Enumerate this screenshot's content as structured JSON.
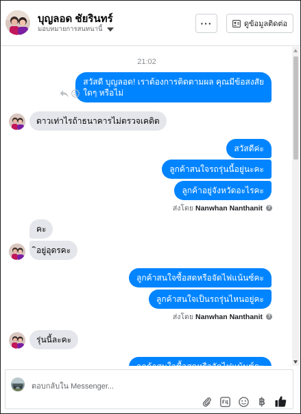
{
  "header": {
    "contact_name": "บุญลอด ชัยรินทร์",
    "assign_label": "มอบหมายการสนทนานี้",
    "more_label": "···",
    "contact_info_label": "ดูข้อมูลติดต่อ"
  },
  "conversation": {
    "timestamp": "21:02",
    "messages": [
      {
        "from": "page",
        "lines": [
          "สวัสดี บุญลอด! เราต้องการติดตามผล คุณมีข้อสงสัย",
          "ใดๆ หรือไม่"
        ]
      },
      {
        "from": "customer",
        "text": "ดาวเท่าไรถ้าธนาคารไม่ตรวจเคดิต"
      },
      {
        "from": "page",
        "text": "สวัสดีค่ะ"
      },
      {
        "from": "page",
        "text": "ลูกค้าสนใจรถรุ่นนี้อยู่นะคะ"
      },
      {
        "from": "page",
        "text": "ลูกค้าอยู่จังหวัดอะไรคะ"
      },
      {
        "from": "customer",
        "text": "คะ"
      },
      {
        "from": "customer",
        "text": "ิอยู่อุดรคะ"
      },
      {
        "from": "page",
        "text": "ลูกค้าสนใจซื้อสดหรือจัดไฟแน้นซ์คะ"
      },
      {
        "from": "page",
        "text": "ลูกค้าสนใจเป็นรถรุ่นไหนอยู่คะ"
      },
      {
        "from": "customer",
        "text": "รุ่นนี้ละคะ"
      },
      {
        "from": "page",
        "text": "ลูกค้าสนใจซื้อสดหรือจัดไฟแน้นซ์คะ"
      }
    ],
    "sent_by_label": "ส่งโดย",
    "sent_by_name": "Nanwhan Nanthanit",
    "help_glyph": "?"
  },
  "composer": {
    "placeholder": "ตอบกลับใน Messenger...",
    "baht_glyph": "฿"
  },
  "colors": {
    "outgoing_bubble": "#0084ff",
    "incoming_bubble": "#e4e6eb",
    "like_icon": "#1c1e21"
  },
  "icons": [
    "options-icon",
    "contact-card-icon",
    "reply-icon",
    "react-icon",
    "attach-icon",
    "gif-icon",
    "emoji-icon",
    "baht-icon",
    "like-icon",
    "help-icon",
    "caret-icon"
  ]
}
